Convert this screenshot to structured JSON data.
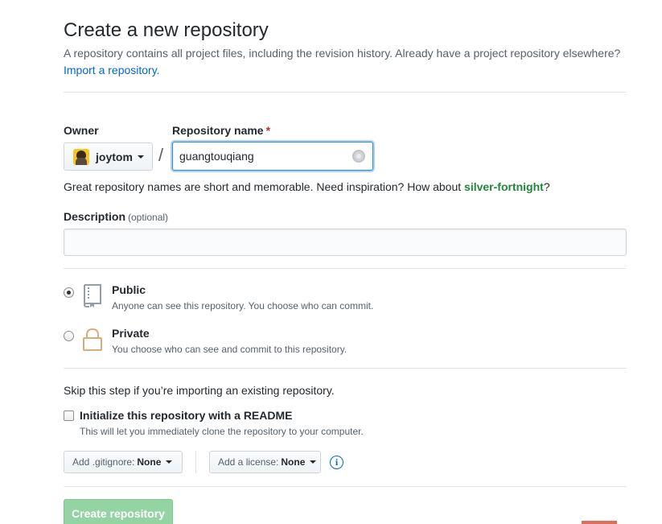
{
  "header": {
    "title": "Create a new repository",
    "subtitle": "A repository contains all project files, including the revision history. Already have a project repository elsewhere?",
    "import_link": "Import a repository."
  },
  "owner": {
    "label": "Owner",
    "value": "joytom"
  },
  "repository_name": {
    "label": "Repository name",
    "required_marker": "*",
    "value": "guangtouqiang",
    "separator": "/"
  },
  "hint": {
    "prefix": "Great repository names are short and memorable. Need inspiration? How about ",
    "suggestion": "silver-fortnight",
    "suffix": "?"
  },
  "description": {
    "label": "Description",
    "optional": "(optional)",
    "value": ""
  },
  "visibility": {
    "selected": "public",
    "options": [
      {
        "key": "public",
        "title": "Public",
        "description": "Anyone can see this repository. You choose who can commit.",
        "icon": "repo-icon"
      },
      {
        "key": "private",
        "title": "Private",
        "description": "You choose who can see and commit to this repository.",
        "icon": "lock-icon"
      }
    ]
  },
  "init": {
    "skip_note": "Skip this step if you’re importing an existing repository.",
    "readme_title": "Initialize this repository with a README",
    "readme_desc": "This will let you immediately clone the repository to your computer.",
    "readme_checked": false
  },
  "gitignore": {
    "label": "Add .gitignore:",
    "value": "None"
  },
  "license": {
    "label": "Add a license:",
    "value": "None"
  },
  "submit": {
    "label": "Create repository",
    "disabled": true
  },
  "colors": {
    "link": "#0366d6",
    "suggestion": "#22863a",
    "required": "#cb2431",
    "create_button": "#94d3a2"
  }
}
